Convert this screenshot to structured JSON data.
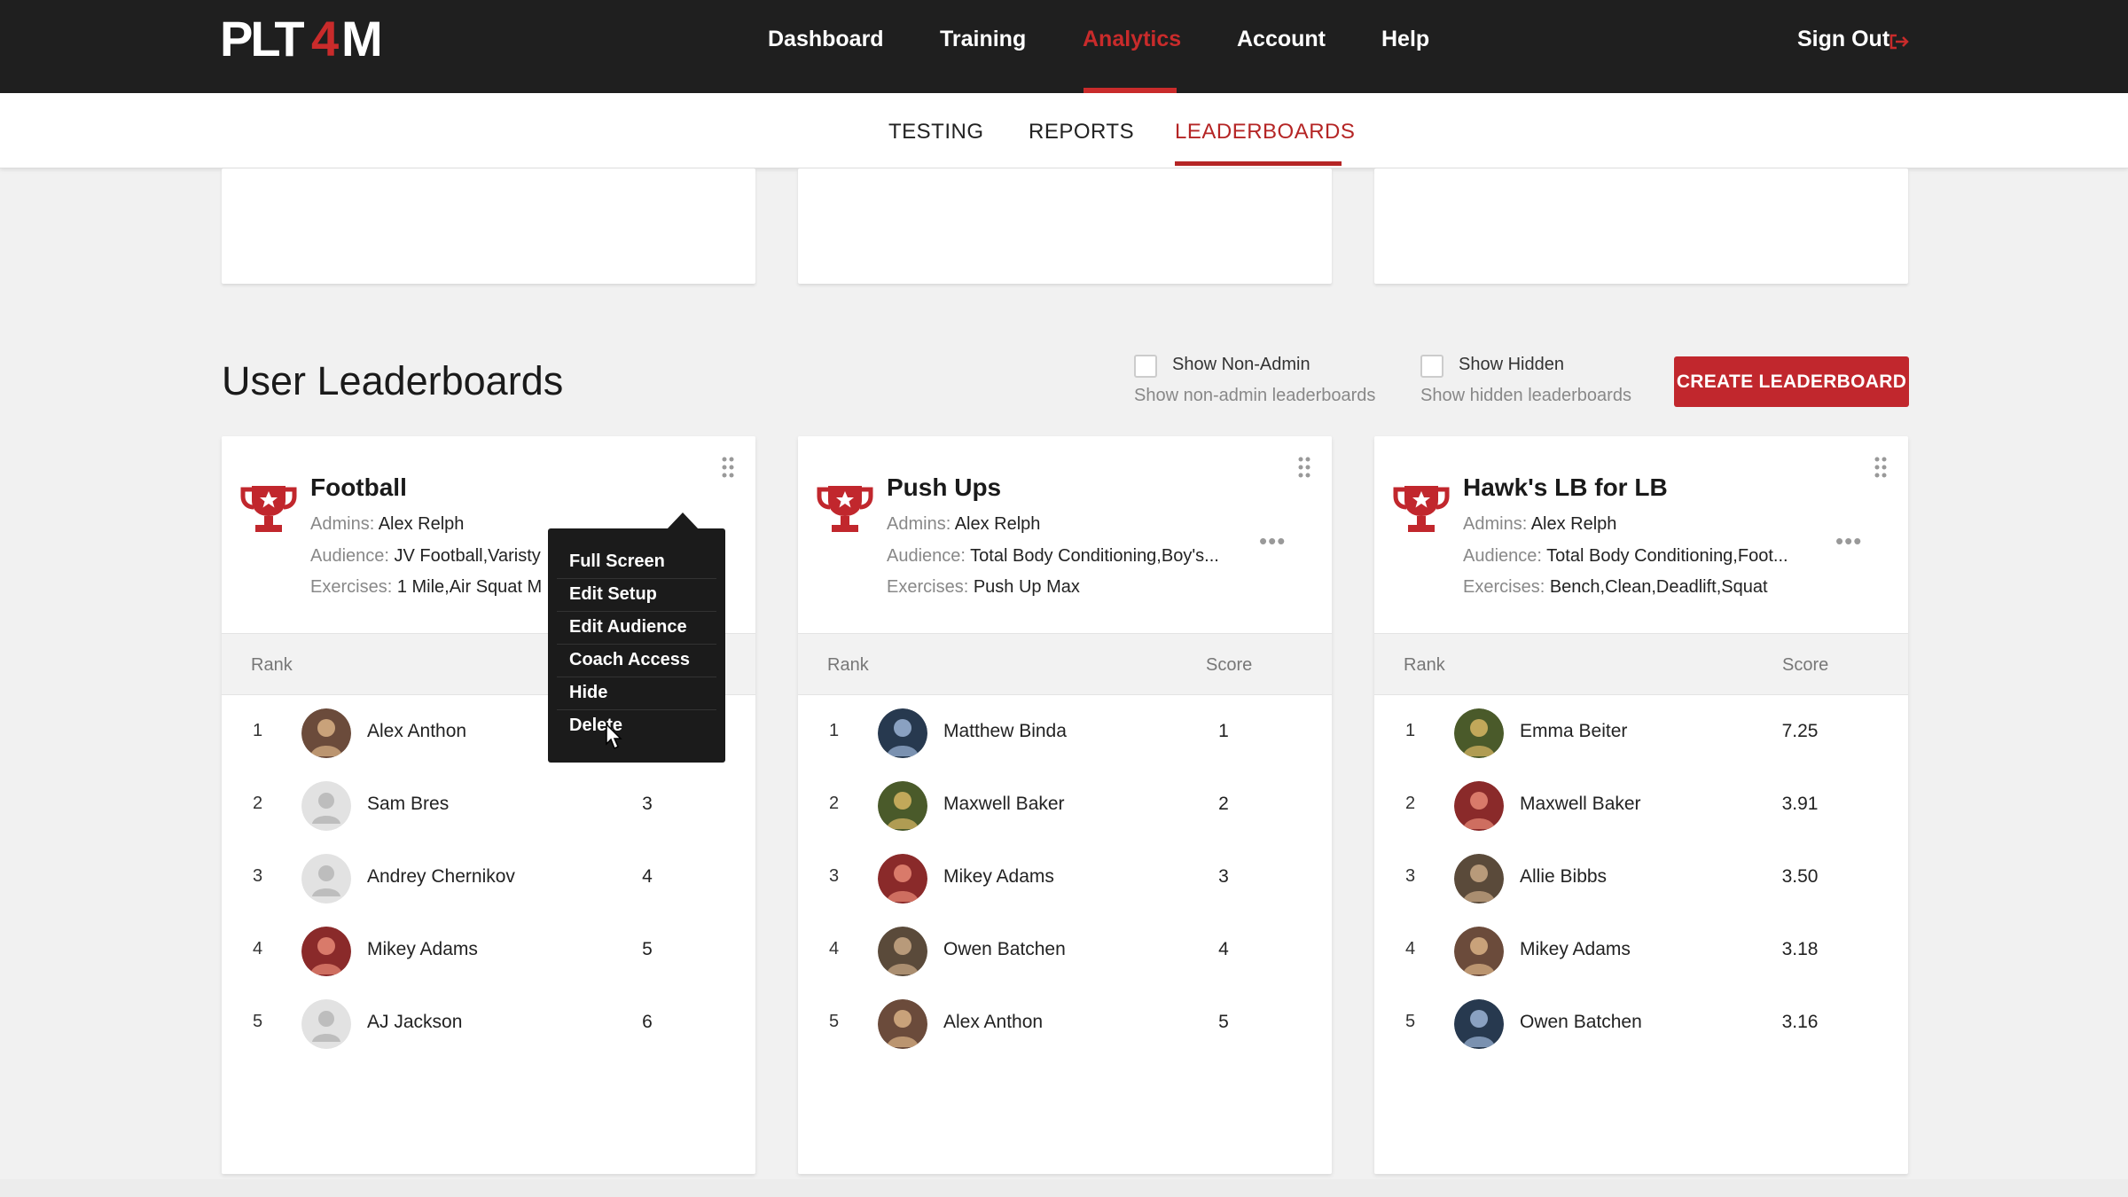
{
  "brand": {
    "logo_text": "PLT4M",
    "accent": "#c1272d"
  },
  "nav": {
    "items": [
      {
        "label": "Dashboard"
      },
      {
        "label": "Training"
      },
      {
        "label": "Analytics"
      },
      {
        "label": "Account"
      },
      {
        "label": "Help"
      }
    ],
    "active": "Analytics",
    "signout": "Sign Out",
    "signout_icon": "sign-out-icon"
  },
  "subnav": {
    "items": [
      {
        "label": "TESTING"
      },
      {
        "label": "REPORTS"
      },
      {
        "label": "LEADERBOARDS"
      }
    ],
    "active": "LEADERBOARDS"
  },
  "section": {
    "title": "User Leaderboards",
    "filters": [
      {
        "label": "Show Non-Admin",
        "sub": "Show non-admin leaderboards",
        "checked": false
      },
      {
        "label": "Show Hidden",
        "sub": "Show hidden leaderboards",
        "checked": false
      }
    ],
    "create_button": "CREATE LEADERBOARD"
  },
  "meta_labels": {
    "admins": "Admins:",
    "audience": "Audience:",
    "exercises": "Exercises:"
  },
  "table_labels": {
    "rank": "Rank",
    "score": "Score"
  },
  "leaderboards": [
    {
      "title": "Football",
      "admins": "Alex Relph",
      "audience": "JV Football,Varisty",
      "exercises": "1 Mile,Air Squat M",
      "rows": [
        {
          "rank": "1",
          "name": "Alex Anthon",
          "score": "",
          "avatar": "photo"
        },
        {
          "rank": "2",
          "name": "Sam Bres",
          "score": "3",
          "avatar": "placeholder"
        },
        {
          "rank": "3",
          "name": "Andrey Chernikov",
          "score": "4",
          "avatar": "placeholder"
        },
        {
          "rank": "4",
          "name": "Mikey Adams",
          "score": "5",
          "avatar": "photo"
        },
        {
          "rank": "5",
          "name": "AJ Jackson",
          "score": "6",
          "avatar": "placeholder"
        }
      ]
    },
    {
      "title": "Push Ups",
      "admins": "Alex Relph",
      "audience": "Total Body Conditioning,Boy's...",
      "exercises": "Push Up Max",
      "rows": [
        {
          "rank": "1",
          "name": "Matthew Binda",
          "score": "1",
          "avatar": "photo"
        },
        {
          "rank": "2",
          "name": "Maxwell Baker",
          "score": "2",
          "avatar": "photo"
        },
        {
          "rank": "3",
          "name": "Mikey Adams",
          "score": "3",
          "avatar": "photo"
        },
        {
          "rank": "4",
          "name": "Owen Batchen",
          "score": "4",
          "avatar": "photo"
        },
        {
          "rank": "5",
          "name": "Alex Anthon",
          "score": "5",
          "avatar": "photo"
        }
      ]
    },
    {
      "title": "Hawk's LB for LB",
      "admins": "Alex Relph",
      "audience": "Total Body Conditioning,Foot...",
      "exercises": "Bench,Clean,Deadlift,Squat",
      "rows": [
        {
          "rank": "1",
          "name": "Emma Beiter",
          "score": "7.25",
          "avatar": "photo"
        },
        {
          "rank": "2",
          "name": "Maxwell Baker",
          "score": "3.91",
          "avatar": "photo"
        },
        {
          "rank": "3",
          "name": "Allie Bibbs",
          "score": "3.50",
          "avatar": "photo"
        },
        {
          "rank": "4",
          "name": "Mikey Adams",
          "score": "3.18",
          "avatar": "photo"
        },
        {
          "rank": "5",
          "name": "Owen Batchen",
          "score": "3.16",
          "avatar": "photo"
        }
      ]
    }
  ],
  "context_menu": {
    "items": [
      "Full Screen",
      "Edit Setup",
      "Edit Audience",
      "Coach Access",
      "Hide",
      "Delete"
    ],
    "hovered": "Delete"
  }
}
